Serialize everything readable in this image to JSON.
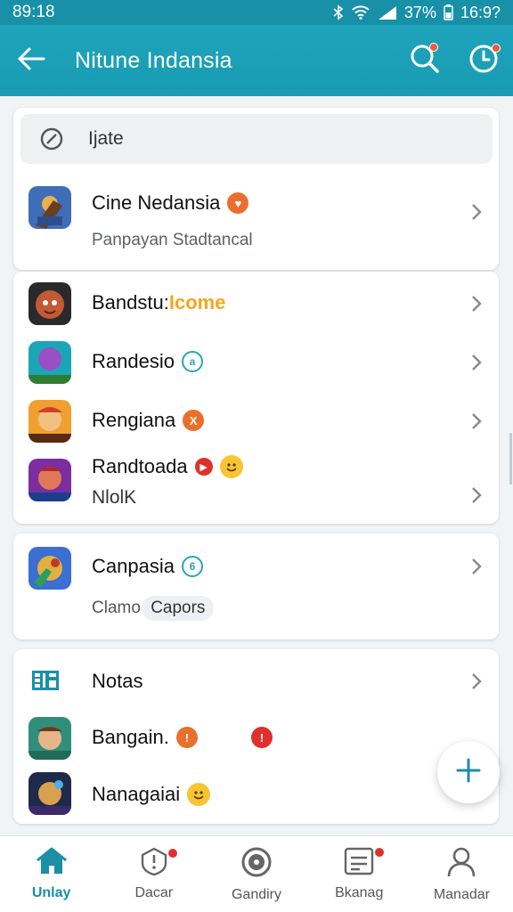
{
  "status_bar": {
    "time": "89:18",
    "battery": "37%",
    "clock": "16:9?",
    "icons": [
      "bluetooth-icon",
      "wifi-icon",
      "signal-icon",
      "battery-icon"
    ]
  },
  "app_bar": {
    "title": "Nitune Indansia",
    "back_icon": "arrow-left-icon",
    "actions": [
      "search-icon",
      "clock-icon"
    ]
  },
  "search": {
    "placeholder": "Ijate"
  },
  "featured": {
    "title": "Cine Nedansia",
    "subtitle": "Panpayan Stadtancal",
    "badge_icon": "heart-icon"
  },
  "group1": [
    {
      "title": "Bandstu:",
      "highlight": "Icome"
    },
    {
      "title": "Randesio",
      "badge": "a"
    },
    {
      "title": "Rengiana",
      "badge": "X"
    },
    {
      "title": "Randtoada",
      "subtitle": "NlolK"
    }
  ],
  "group2": {
    "title": "Canpasia",
    "badge": "6",
    "subtitle": "Clamo",
    "chip": "Capors"
  },
  "group3": [
    {
      "title": "Notas",
      "icon": "table-icon"
    },
    {
      "title": "Bangain.",
      "badge": "!"
    },
    {
      "title": "Nanagaiai"
    }
  ],
  "bottom_nav": [
    {
      "label": "Unlay",
      "icon": "home-icon",
      "active": true
    },
    {
      "label": "Dacar",
      "icon": "alert-icon"
    },
    {
      "label": "Gandiry",
      "icon": "disc-icon"
    },
    {
      "label": "Bkanag",
      "icon": "list-icon"
    },
    {
      "label": "Manadar",
      "icon": "person-icon"
    }
  ],
  "colors": {
    "primary": "#1ea4bb",
    "accent": "#e9702c",
    "badge_red": "#e0302c",
    "active_nav": "#1a8fa6"
  }
}
